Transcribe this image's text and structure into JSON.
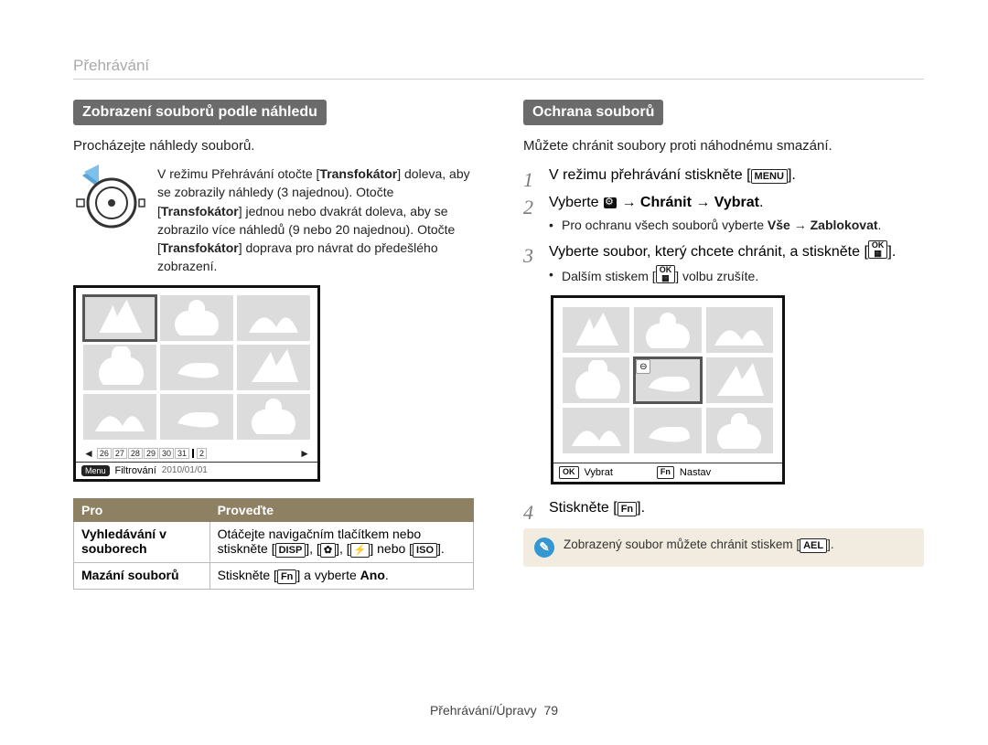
{
  "breadcrumb": "Přehrávání",
  "left": {
    "sectionTitle": "Zobrazení souborů podle náhledu",
    "intro": "Procházejte náhledy souborů.",
    "dialText": {
      "l1a": "V režimu Přehrávání otočte [",
      "transfokator": "Transfokátor",
      "l1b": "] doleva, aby se zobrazily náhledy (3 najednou). Otočte [",
      "l2": "] jednou nebo dvakrát doleva, aby se zobrazilo více náhledů (9 nebo 20 najednou). Otočte [",
      "l3": "] doprava pro návrat do předešlého zobrazení."
    },
    "filmstrip": {
      "days": [
        "26",
        "27",
        "28",
        "29",
        "30",
        "31"
      ],
      "extra": "2"
    },
    "screenStatus": {
      "menuChip": "Menu",
      "filterLabel": "Filtrování",
      "date": "2010/01/01"
    },
    "table": {
      "head": [
        "Pro",
        "Proveďte"
      ],
      "row1": {
        "label": "Vyhledávání v souborech",
        "text1": "Otáčejte navigačním tlačítkem nebo stiskněte [",
        "kDisp": "DISP",
        "kFlower": "✿",
        "kFlash": "⚡",
        "or": "] nebo [",
        "kIso": "ISO",
        "end": "]."
      },
      "row2": {
        "label": "Mazání souborů",
        "text1": "Stiskněte [",
        "kFn": "Fn",
        "text2": "] a vyberte ",
        "ano": "Ano",
        "end": "."
      }
    }
  },
  "right": {
    "sectionTitle": "Ochrana souborů",
    "intro": "Můžete chránit soubory proti náhodnému smazání.",
    "steps": {
      "s1a": "V režimu přehrávání stiskněte [",
      "s1menu": "MENU",
      "s1b": "].",
      "s2a": "Vyberte ",
      "s2arrow": " → ",
      "s2chranit": "Chránit",
      "s2vybrat": "Vybrat",
      "s2end": ".",
      "s2sub1": "Pro ochranu všech souborů vyberte ",
      "s2vse": "Vše",
      "s2zabl": "Zablokovat",
      "s2subend": ".",
      "s3a": "Vyberte soubor, který chcete chránit, a stiskněte [",
      "s3ok": "OK",
      "s3b": "].",
      "s3sub": "Dalším stiskem [",
      "s3subend": "] volbu zrušíte.",
      "s4a": "Stiskněte [",
      "s4fn": "Fn",
      "s4b": "]."
    },
    "protectStatus": {
      "okChip": "OK",
      "okLabel": "Vybrat",
      "fnChip": "Fn",
      "fnLabel": "Nastav"
    },
    "note": {
      "text1": "Zobrazený soubor můžete chránit stiskem [",
      "ael": "AEL",
      "text2": "]."
    }
  },
  "footer": {
    "label": "Přehrávání/Úpravy",
    "page": "79"
  }
}
